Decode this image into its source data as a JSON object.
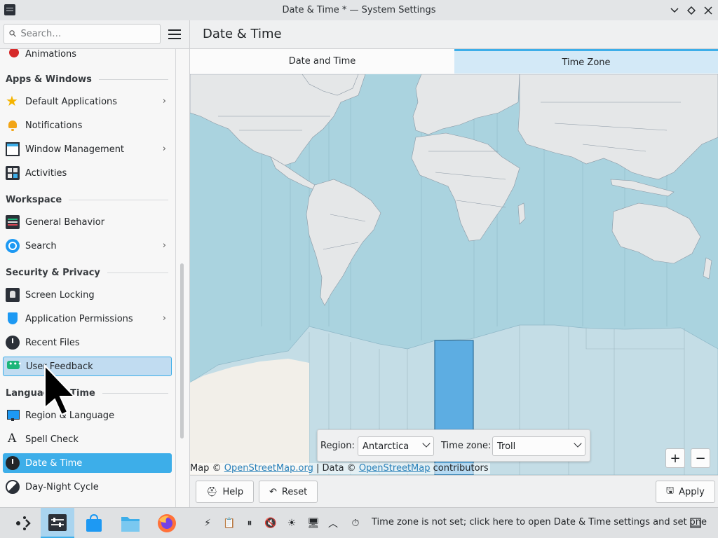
{
  "window": {
    "title": "Date & Time * — System Settings"
  },
  "header": {
    "search_placeholder": "Search…",
    "page_title": "Date & Time"
  },
  "sidebar": {
    "items": [
      {
        "label": "Animations"
      },
      {
        "section": "Apps & Windows"
      },
      {
        "label": "Default Applications"
      },
      {
        "label": "Notifications"
      },
      {
        "label": "Window Management"
      },
      {
        "label": "Activities"
      },
      {
        "section": "Workspace"
      },
      {
        "label": "General Behavior"
      },
      {
        "label": "Search"
      },
      {
        "section": "Security & Privacy"
      },
      {
        "label": "Screen Locking"
      },
      {
        "label": "Application Permissions"
      },
      {
        "label": "Recent Files"
      },
      {
        "label": "User Feedback"
      },
      {
        "section": "Language & Time"
      },
      {
        "label": "Region & Language"
      },
      {
        "label": "Spell Check"
      },
      {
        "label": "Date & Time"
      },
      {
        "label": "Day-Night Cycle"
      }
    ]
  },
  "tabs": [
    {
      "label": "Date and Time"
    },
    {
      "label": "Time Zone"
    }
  ],
  "timezone": {
    "region_label": "Region:",
    "region_value": "Antarctica",
    "tz_label": "Time zone:",
    "tz_value": "Troll"
  },
  "map": {
    "attrib_prefix": "Map ©",
    "attrib_link1": "OpenStreetMap.org",
    "attrib_mid": "| Data ©",
    "attrib_link2": "OpenStreetMap",
    "attrib_suffix": "contributors",
    "zoom_in": "+",
    "zoom_out": "−"
  },
  "footer": {
    "help": "Help",
    "reset": "Reset",
    "apply": "Apply"
  },
  "taskbar": {
    "notification": "Time zone is not set; click here to open Date & Time settings and set one"
  },
  "colors": {
    "accent": "#3daee9",
    "ocean": "#aad3df",
    "land": "#f2efe9",
    "selected_zone": "#5dade2"
  }
}
